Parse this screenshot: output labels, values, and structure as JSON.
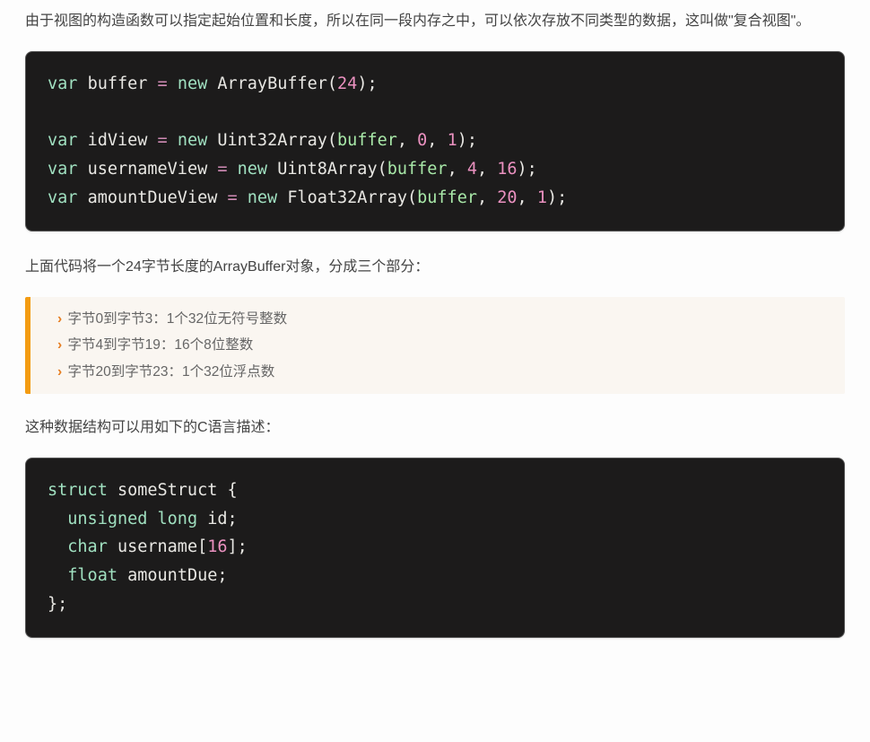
{
  "paragraphs": {
    "intro": "由于视图的构造函数可以指定起始位置和长度，所以在同一段内存之中，可以依次存放不同类型的数据，这叫做\"复合视图\"。",
    "after_code1": "上面代码将一个24字节长度的ArrayBuffer对象，分成三个部分：",
    "after_quote": "这种数据结构可以用如下的C语言描述："
  },
  "code1": {
    "tokens": [
      {
        "t": "kw",
        "v": "var"
      },
      {
        "t": "sp",
        "v": " "
      },
      {
        "t": "id",
        "v": "buffer"
      },
      {
        "t": "sp",
        "v": " "
      },
      {
        "t": "op",
        "v": "="
      },
      {
        "t": "sp",
        "v": " "
      },
      {
        "t": "kw",
        "v": "new"
      },
      {
        "t": "sp",
        "v": " "
      },
      {
        "t": "cls",
        "v": "ArrayBuffer"
      },
      {
        "t": "pn",
        "v": "("
      },
      {
        "t": "num",
        "v": "24"
      },
      {
        "t": "pn",
        "v": ");"
      },
      {
        "t": "nl"
      },
      {
        "t": "nl"
      },
      {
        "t": "kw",
        "v": "var"
      },
      {
        "t": "sp",
        "v": " "
      },
      {
        "t": "id",
        "v": "idView"
      },
      {
        "t": "sp",
        "v": " "
      },
      {
        "t": "op",
        "v": "="
      },
      {
        "t": "sp",
        "v": " "
      },
      {
        "t": "kw",
        "v": "new"
      },
      {
        "t": "sp",
        "v": " "
      },
      {
        "t": "cls",
        "v": "Uint32Array"
      },
      {
        "t": "pn",
        "v": "("
      },
      {
        "t": "arg",
        "v": "buffer"
      },
      {
        "t": "pn",
        "v": ", "
      },
      {
        "t": "num",
        "v": "0"
      },
      {
        "t": "pn",
        "v": ", "
      },
      {
        "t": "num",
        "v": "1"
      },
      {
        "t": "pn",
        "v": ");"
      },
      {
        "t": "nl"
      },
      {
        "t": "kw",
        "v": "var"
      },
      {
        "t": "sp",
        "v": " "
      },
      {
        "t": "id",
        "v": "usernameView"
      },
      {
        "t": "sp",
        "v": " "
      },
      {
        "t": "op",
        "v": "="
      },
      {
        "t": "sp",
        "v": " "
      },
      {
        "t": "kw",
        "v": "new"
      },
      {
        "t": "sp",
        "v": " "
      },
      {
        "t": "cls",
        "v": "Uint8Array"
      },
      {
        "t": "pn",
        "v": "("
      },
      {
        "t": "arg",
        "v": "buffer"
      },
      {
        "t": "pn",
        "v": ", "
      },
      {
        "t": "num",
        "v": "4"
      },
      {
        "t": "pn",
        "v": ", "
      },
      {
        "t": "num",
        "v": "16"
      },
      {
        "t": "pn",
        "v": ");"
      },
      {
        "t": "nl"
      },
      {
        "t": "kw",
        "v": "var"
      },
      {
        "t": "sp",
        "v": " "
      },
      {
        "t": "id",
        "v": "amountDueView"
      },
      {
        "t": "sp",
        "v": " "
      },
      {
        "t": "op",
        "v": "="
      },
      {
        "t": "sp",
        "v": " "
      },
      {
        "t": "kw",
        "v": "new"
      },
      {
        "t": "sp",
        "v": " "
      },
      {
        "t": "cls",
        "v": "Float32Array"
      },
      {
        "t": "pn",
        "v": "("
      },
      {
        "t": "arg",
        "v": "buffer"
      },
      {
        "t": "pn",
        "v": ", "
      },
      {
        "t": "num",
        "v": "20"
      },
      {
        "t": "pn",
        "v": ", "
      },
      {
        "t": "num",
        "v": "1"
      },
      {
        "t": "pn",
        "v": ");"
      }
    ]
  },
  "quote_items": [
    "字节0到字节3：1个32位无符号整数",
    "字节4到字节19：16个8位整数",
    "字节20到字节23：1个32位浮点数"
  ],
  "code2": {
    "tokens": [
      {
        "t": "kw",
        "v": "struct"
      },
      {
        "t": "sp",
        "v": " "
      },
      {
        "t": "id",
        "v": "someStruct"
      },
      {
        "t": "sp",
        "v": " "
      },
      {
        "t": "pn",
        "v": "{"
      },
      {
        "t": "nl"
      },
      {
        "t": "sp",
        "v": "  "
      },
      {
        "t": "kw",
        "v": "unsigned"
      },
      {
        "t": "sp",
        "v": " "
      },
      {
        "t": "kw",
        "v": "long"
      },
      {
        "t": "sp",
        "v": " "
      },
      {
        "t": "id",
        "v": "id"
      },
      {
        "t": "pn",
        "v": ";"
      },
      {
        "t": "nl"
      },
      {
        "t": "sp",
        "v": "  "
      },
      {
        "t": "kw",
        "v": "char"
      },
      {
        "t": "sp",
        "v": " "
      },
      {
        "t": "id",
        "v": "username"
      },
      {
        "t": "pn",
        "v": "["
      },
      {
        "t": "num",
        "v": "16"
      },
      {
        "t": "pn",
        "v": "];"
      },
      {
        "t": "nl"
      },
      {
        "t": "sp",
        "v": "  "
      },
      {
        "t": "kw",
        "v": "float"
      },
      {
        "t": "sp",
        "v": " "
      },
      {
        "t": "id",
        "v": "amountDue"
      },
      {
        "t": "pn",
        "v": ";"
      },
      {
        "t": "nl"
      },
      {
        "t": "pn",
        "v": "};"
      }
    ]
  }
}
